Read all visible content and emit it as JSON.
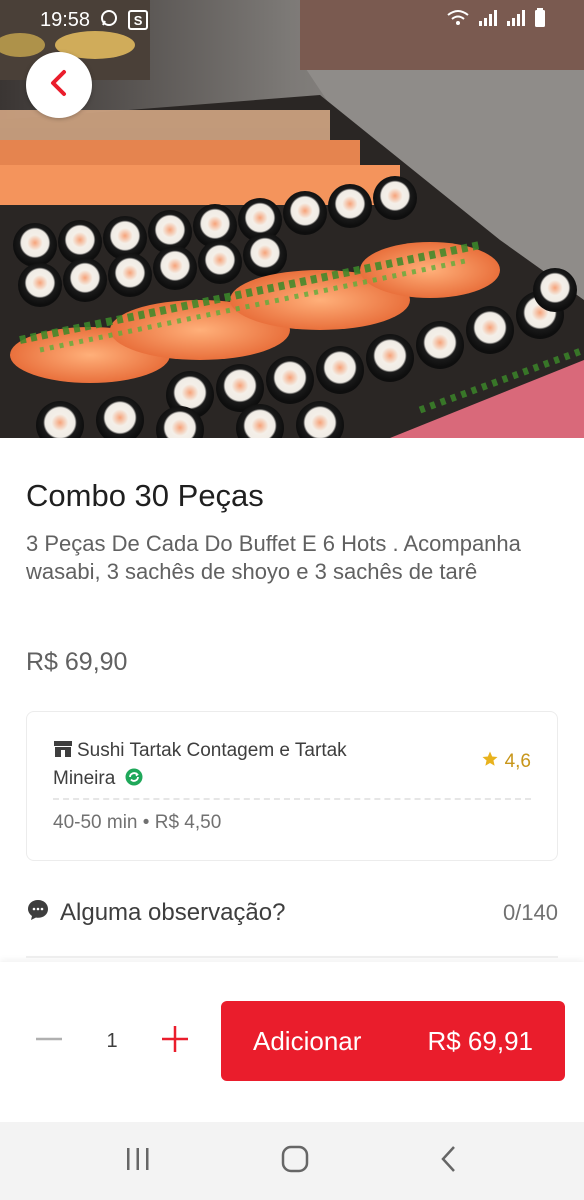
{
  "status_bar": {
    "time": "19:58",
    "app_badge": "S",
    "icons": [
      "whatsapp-icon",
      "wifi-icon",
      "signal-icon",
      "signal-icon",
      "battery-icon"
    ]
  },
  "hero": {
    "description_icon": "sushi-photo"
  },
  "product": {
    "title": "Combo 30 Peças",
    "description": "3 Peças De Cada Do Buffet E 6 Hots . Acompanha wasabi, 3 sachês de shoyo e 3 sachês de tarê",
    "price": "R$ 69,90"
  },
  "store": {
    "name": "Sushi Tartak Contagem e Tartak Mineira",
    "rating": "4,6",
    "delivery_time": "40-50 min",
    "separator": "•",
    "delivery_fee": "R$ 4,50"
  },
  "observation": {
    "label": "Alguma observação?",
    "count": "0/140"
  },
  "cart": {
    "quantity": "1",
    "add_label": "Adicionar",
    "total": "R$ 69,91"
  },
  "colors": {
    "primary": "#ea1d2c",
    "rating_star": "#e8b21d",
    "verified": "#1fa85a"
  }
}
